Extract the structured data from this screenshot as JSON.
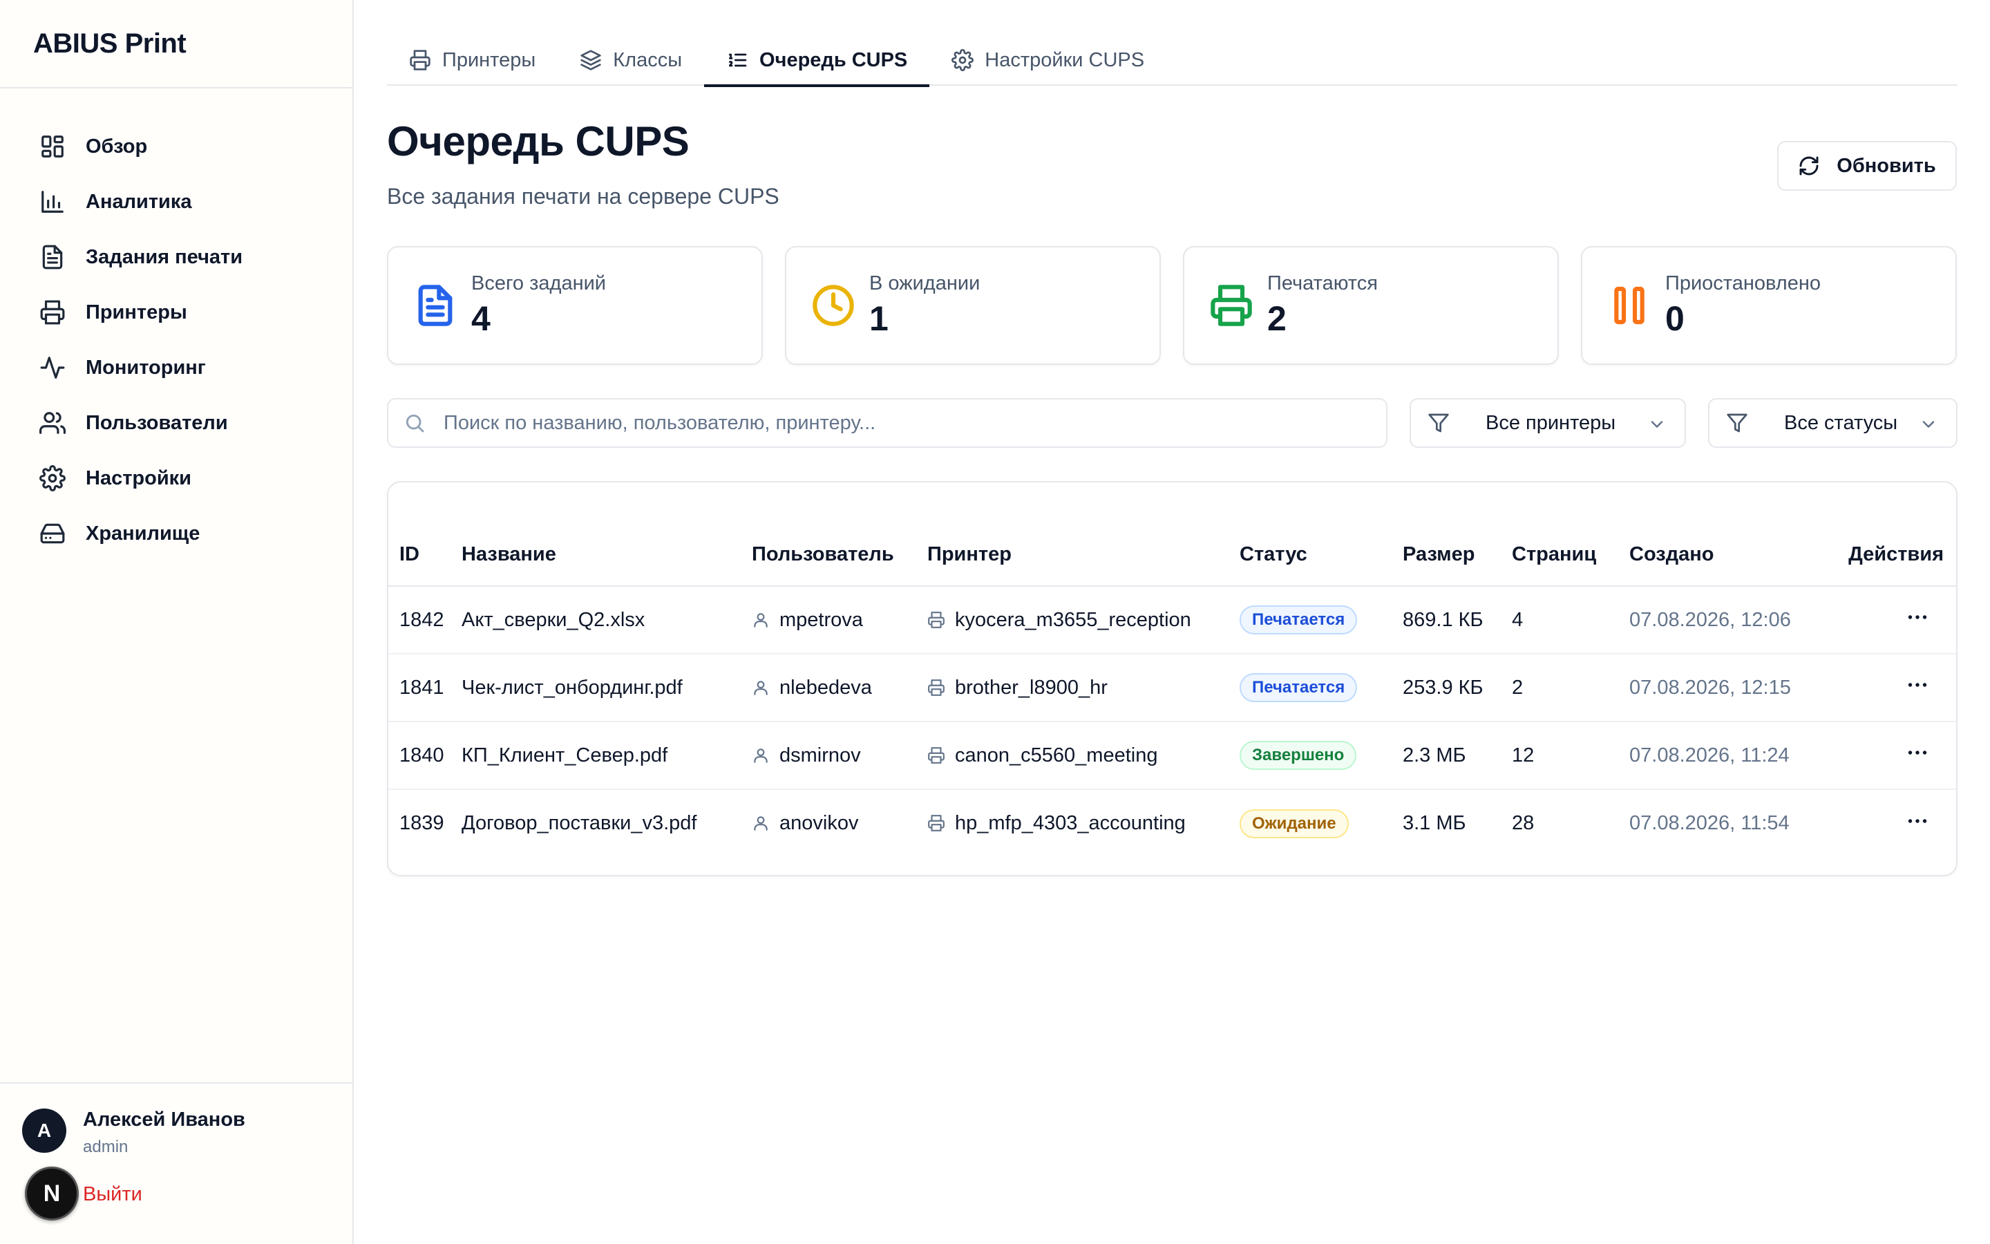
{
  "sidebar": {
    "brand": "ABIUS Print",
    "items": [
      {
        "label": "Обзор",
        "icon": "dashboard-icon"
      },
      {
        "label": "Аналитика",
        "icon": "bar-chart-icon"
      },
      {
        "label": "Задания печати",
        "icon": "document-icon"
      },
      {
        "label": "Принтеры",
        "icon": "printer-icon"
      },
      {
        "label": "Мониторинг",
        "icon": "activity-icon"
      },
      {
        "label": "Пользователи",
        "icon": "users-icon"
      },
      {
        "label": "Настройки",
        "icon": "gear-icon"
      },
      {
        "label": "Хранилище",
        "icon": "hard-drive-icon"
      }
    ],
    "user": {
      "initial": "A",
      "name": "Алексей Иванов",
      "role": "admin"
    },
    "next_badge": "N",
    "logout": "Выйти"
  },
  "tabs": [
    {
      "label": "Принтеры",
      "icon": "printer-icon",
      "active": false
    },
    {
      "label": "Классы",
      "icon": "layers-icon",
      "active": false
    },
    {
      "label": "Очередь CUPS",
      "icon": "list-ordered-icon",
      "active": true
    },
    {
      "label": "Настройки CUPS",
      "icon": "gear-icon",
      "active": false
    }
  ],
  "header": {
    "title": "Очередь CUPS",
    "subtitle": "Все задания печати на сервере CUPS",
    "refresh_label": "Обновить"
  },
  "stats": [
    {
      "label": "Всего заданий",
      "value": "4",
      "icon": "document-icon",
      "color": "#2563eb"
    },
    {
      "label": "В ожидании",
      "value": "1",
      "icon": "clock-icon",
      "color": "#eab308"
    },
    {
      "label": "Печатаются",
      "value": "2",
      "icon": "printer-icon",
      "color": "#16a34a"
    },
    {
      "label": "Приостановлено",
      "value": "0",
      "icon": "pause-icon",
      "color": "#f97316"
    }
  ],
  "filters": {
    "search_placeholder": "Поиск по названию, пользователю, принтеру...",
    "search_value": "",
    "printer_filter": "Все принтеры",
    "status_filter": "Все статусы"
  },
  "table": {
    "headers": {
      "id": "ID",
      "name": "Название",
      "user": "Пользователь",
      "printer": "Принтер",
      "status": "Статус",
      "size": "Размер",
      "pages": "Страниц",
      "created": "Создано",
      "actions": "Действия"
    },
    "rows": [
      {
        "id": "1842",
        "name": "Акт_сверки_Q2.xlsx",
        "user": "mpetrova",
        "printer": "kyocera_m3655_reception",
        "status": "Печатается",
        "size": "869.1 КБ",
        "pages": "4",
        "created": "07.08.2026, 12:06"
      },
      {
        "id": "1841",
        "name": "Чек-лист_онбординг.pdf",
        "user": "nlebedeva",
        "printer": "brother_l8900_hr",
        "status": "Печатается",
        "size": "253.9 КБ",
        "pages": "2",
        "created": "07.08.2026, 12:15"
      },
      {
        "id": "1840",
        "name": "КП_Клиент_Север.pdf",
        "user": "dsmirnov",
        "printer": "canon_c5560_meeting",
        "status": "Завершено",
        "size": "2.3 МБ",
        "pages": "12",
        "created": "07.08.2026, 11:24"
      },
      {
        "id": "1839",
        "name": "Договор_поставки_v3.pdf",
        "user": "anovikov",
        "printer": "hp_mfp_4303_accounting",
        "status": "Ожидание",
        "size": "3.1 МБ",
        "pages": "28",
        "created": "07.08.2026, 11:54"
      }
    ],
    "status_colors": {
      "Печатается": {
        "bg": "#eff6ff",
        "border": "#bfdbfe",
        "text": "#1d4ed8"
      },
      "Завершено": {
        "bg": "#f0fdf4",
        "border": "#bbf7d0",
        "text": "#15803d"
      },
      "Ожидание": {
        "bg": "#fefce8",
        "border": "#fde68a",
        "text": "#a16207"
      }
    }
  }
}
